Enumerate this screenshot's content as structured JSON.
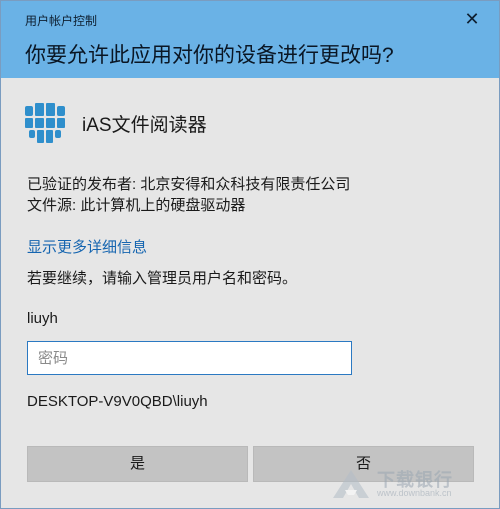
{
  "header": {
    "title": "用户帐户控制",
    "question": "你要允许此应用对你的设备进行更改吗?",
    "close_glyph": "✕"
  },
  "app": {
    "name": "iAS文件阅读器",
    "icon": "app-grid-icon",
    "icon_color": "#2f8fcc"
  },
  "details": {
    "publisher": "已验证的发布者: 北京安得和众科技有限责任公司",
    "origin": "文件源: 此计算机上的硬盘驱动器",
    "more_link": "显示更多详细信息"
  },
  "credentials": {
    "prompt": "若要继续，请输入管理员用户名和密码。",
    "username": "liuyh",
    "password_placeholder": "密码",
    "password_value": "",
    "domain_user": "DESKTOP-V9V0QBD\\liuyh"
  },
  "buttons": {
    "yes": "是",
    "no": "否"
  },
  "watermark": {
    "text": "下载银行",
    "url": "www.downbank.cn"
  },
  "colors": {
    "header_bg": "#6ab2e6",
    "body_bg": "#e6e6e6",
    "link": "#1565b0",
    "button_bg": "#c3c3c3",
    "input_border": "#2b79c2"
  }
}
